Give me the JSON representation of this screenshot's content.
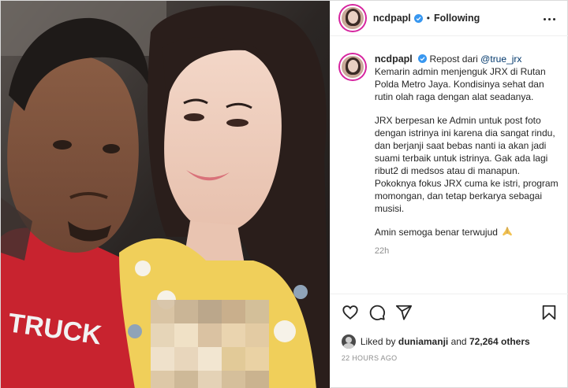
{
  "post": {
    "username": "ncdpapl",
    "follow_status": "Following",
    "caption": {
      "username": "ncdpapl",
      "repost_prefix": "Repost dari",
      "repost_mention": "@true_jrx",
      "paragraph_1": "Kemarin admin menjenguk JRX di Rutan Polda Metro Jaya. Kondisinya sehat dan rutin olah raga dengan alat seadanya.",
      "paragraph_2": "JRX berpesan ke Admin untuk post foto dengan istrinya ini karena dia sangat rindu, dan berjanji saat bebas nanti ia akan jadi suami terbaik untuk istrinya. Gak ada lagi ribut2 di medsos atau di manapun. Pokoknya fokus JRX cuma ke istri, program momongan, dan tetap berkarya sebagai musisi.",
      "paragraph_3": "Amin semoga benar terwujud",
      "time": "22h"
    },
    "likes": {
      "prefix": "Liked by",
      "user": "duniamanji",
      "connector": "and",
      "count": "72,264 others"
    },
    "posted_ago": "22 HOURS AGO"
  },
  "icons": {
    "verified": "verified-badge-icon",
    "more": "more-options-icon",
    "like": "heart-icon",
    "comment": "comment-icon",
    "share": "share-icon",
    "save": "bookmark-icon",
    "emoji": "praying-hands-icon"
  },
  "colors": {
    "verified_blue": "#3897f0",
    "link": "#00376b",
    "muted": "#8e8e8e",
    "story_ring": "#d6249f"
  }
}
